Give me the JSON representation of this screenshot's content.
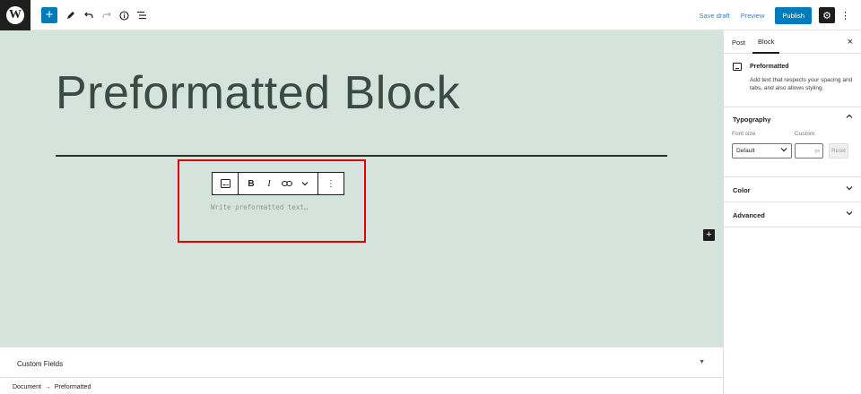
{
  "topbar": {
    "logo_letter": "W",
    "add_icon": "plus-icon",
    "tools_icon": "pencil-icon",
    "undo_icon": "undo-icon",
    "redo_icon": "redo-icon",
    "info_icon": "info-icon",
    "list_view_icon": "list-view-icon",
    "save_draft": "Save draft",
    "preview": "Preview",
    "publish": "Publish",
    "settings_icon": "gear-icon",
    "options_icon": "kebab-icon"
  },
  "canvas": {
    "title": "Preformatted Block",
    "placeholder": "Write preformatted text…",
    "background": "#d4e3dc",
    "highlight_color": "#e00000"
  },
  "block_toolbar": {
    "transform_icon": "preformatted-icon",
    "bold": "B",
    "italic": "I",
    "link_icon": "link-icon",
    "more_icon": "chevron-down-icon",
    "options_icon": "kebab-icon"
  },
  "custom_fields": {
    "label": "Custom Fields"
  },
  "breadcrumb": {
    "items": [
      "Document",
      "→",
      "Preformatted"
    ]
  },
  "sidebar": {
    "tabs": [
      {
        "label": "Post",
        "active": false
      },
      {
        "label": "Block",
        "active": true
      }
    ],
    "block_card": {
      "title": "Preformatted",
      "description": "Add text that respects your spacing and tabs, and also allows styling."
    },
    "typography": {
      "title": "Typography",
      "font_size_label": "Font size",
      "custom_label": "Custom",
      "select_value": "Default",
      "unit": "px",
      "reset": "Reset"
    },
    "color": {
      "title": "Color"
    },
    "advanced": {
      "title": "Advanced"
    }
  },
  "colors": {
    "accent": "#007cba",
    "dark": "#1e1e1e"
  }
}
